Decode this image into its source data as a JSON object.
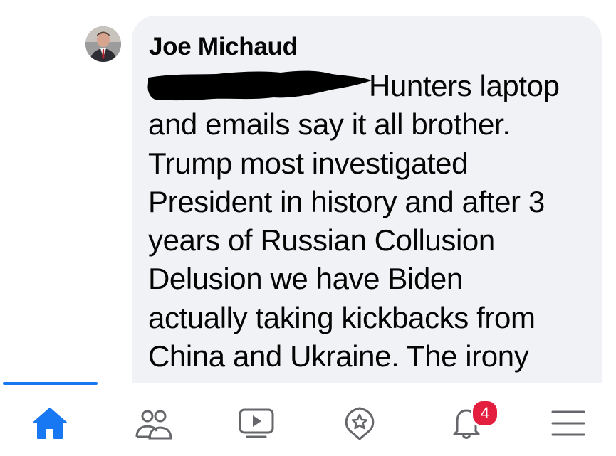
{
  "post": {
    "author": "Joe Michaud",
    "comment_lines": [
      "Hunters laptop",
      "and emails say it all brother.",
      "Trump most investigated",
      "President in history and after 3",
      "years of Russian Collusion",
      "Delusion we have Biden",
      "actually taking kickbacks from",
      "China and Ukraine. The irony"
    ]
  },
  "nav": {
    "active_tab": "home",
    "notification_count": "4"
  },
  "colors": {
    "accent": "#1877f2",
    "icon_gray": "#65676b",
    "badge": "#e41e3f",
    "bubble": "#f0f2f5"
  },
  "icons": [
    "home-icon",
    "friends-icon",
    "watch-icon",
    "marketplace-icon",
    "bell-icon",
    "menu-icon"
  ]
}
